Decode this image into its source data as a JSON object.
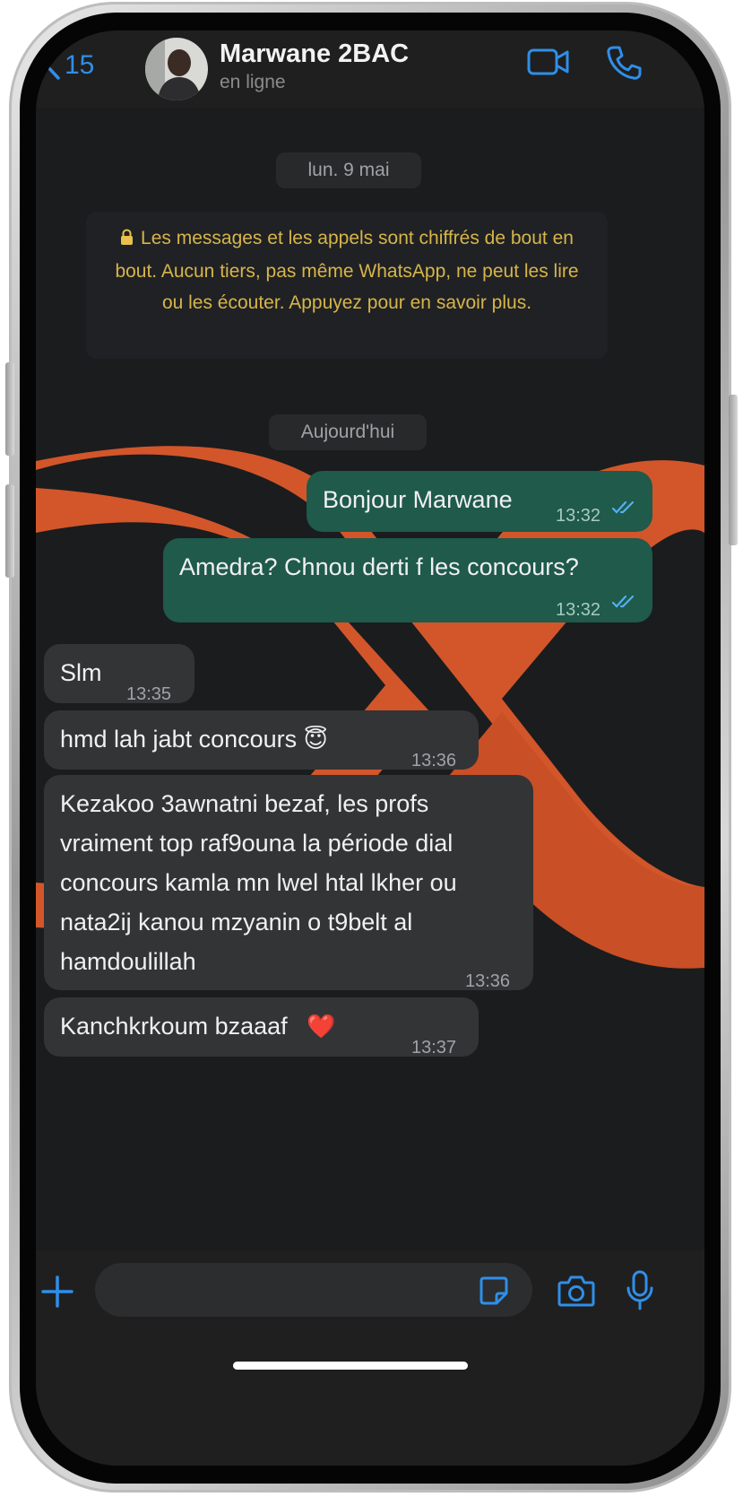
{
  "header": {
    "back_count": "15",
    "contact_name": "Marwane 2BAC",
    "contact_status": "en ligne"
  },
  "chat": {
    "date_old": "lun. 9 mai",
    "encryption_notice": "Les messages et les appels sont chiffrés de bout en bout. Aucun tiers, pas même WhatsApp, ne peut les lire ou les écouter. Appuyez pour en savoir plus.",
    "date_today": "Aujourd'hui",
    "messages": [
      {
        "direction": "out",
        "text": "Bonjour Marwane",
        "time": "13:32",
        "status": "read"
      },
      {
        "direction": "out",
        "text": "Amedra? Chnou derti f les concours?",
        "time": "13:32",
        "status": "read"
      },
      {
        "direction": "in",
        "text": "Slm",
        "time": "13:35"
      },
      {
        "direction": "in",
        "text": "hmd lah jabt concours",
        "emoji": "😇",
        "time": "13:36"
      },
      {
        "direction": "in",
        "lines": [
          "Kezakoo 3awnatni bezaf, les profs",
          "vraiment top raf9ouna la période dial",
          "concours kamla mn lwel htal lkher ou",
          "nata2ij kanou mzyanin o t9belt al",
          "hamdoulillah"
        ],
        "time": "13:36"
      },
      {
        "direction": "in",
        "text": "Kanchkrkoum bzaaaf",
        "emoji": "❤️",
        "time": "13:37"
      }
    ]
  },
  "colors": {
    "accent": "#2f8fe8",
    "outgoing_bubble": "#1f5a4b",
    "incoming_bubble": "#333436",
    "wallpaper_orange": "#d2562a",
    "notice_text": "#d6b54a"
  },
  "icons": [
    "chevron-left-icon",
    "video-call-icon",
    "phone-call-icon",
    "lock-icon",
    "double-check-icon",
    "plus-icon",
    "sticker-icon",
    "camera-icon",
    "microphone-icon"
  ]
}
